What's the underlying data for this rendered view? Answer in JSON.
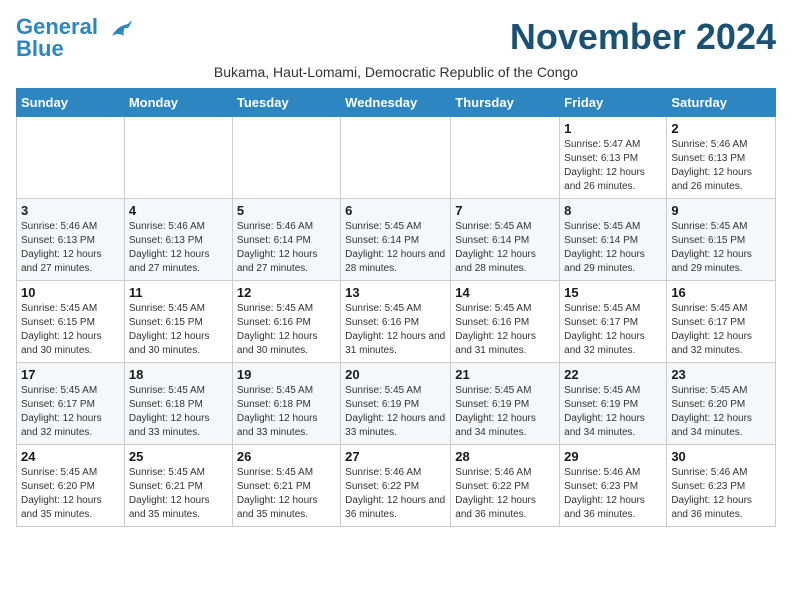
{
  "logo": {
    "line1": "General",
    "line2": "Blue"
  },
  "title": "November 2024",
  "subtitle": "Bukama, Haut-Lomami, Democratic Republic of the Congo",
  "days_of_week": [
    "Sunday",
    "Monday",
    "Tuesday",
    "Wednesday",
    "Thursday",
    "Friday",
    "Saturday"
  ],
  "weeks": [
    [
      {
        "day": "",
        "info": ""
      },
      {
        "day": "",
        "info": ""
      },
      {
        "day": "",
        "info": ""
      },
      {
        "day": "",
        "info": ""
      },
      {
        "day": "",
        "info": ""
      },
      {
        "day": "1",
        "info": "Sunrise: 5:47 AM\nSunset: 6:13 PM\nDaylight: 12 hours and 26 minutes."
      },
      {
        "day": "2",
        "info": "Sunrise: 5:46 AM\nSunset: 6:13 PM\nDaylight: 12 hours and 26 minutes."
      }
    ],
    [
      {
        "day": "3",
        "info": "Sunrise: 5:46 AM\nSunset: 6:13 PM\nDaylight: 12 hours and 27 minutes."
      },
      {
        "day": "4",
        "info": "Sunrise: 5:46 AM\nSunset: 6:13 PM\nDaylight: 12 hours and 27 minutes."
      },
      {
        "day": "5",
        "info": "Sunrise: 5:46 AM\nSunset: 6:14 PM\nDaylight: 12 hours and 27 minutes."
      },
      {
        "day": "6",
        "info": "Sunrise: 5:45 AM\nSunset: 6:14 PM\nDaylight: 12 hours and 28 minutes."
      },
      {
        "day": "7",
        "info": "Sunrise: 5:45 AM\nSunset: 6:14 PM\nDaylight: 12 hours and 28 minutes."
      },
      {
        "day": "8",
        "info": "Sunrise: 5:45 AM\nSunset: 6:14 PM\nDaylight: 12 hours and 29 minutes."
      },
      {
        "day": "9",
        "info": "Sunrise: 5:45 AM\nSunset: 6:15 PM\nDaylight: 12 hours and 29 minutes."
      }
    ],
    [
      {
        "day": "10",
        "info": "Sunrise: 5:45 AM\nSunset: 6:15 PM\nDaylight: 12 hours and 30 minutes."
      },
      {
        "day": "11",
        "info": "Sunrise: 5:45 AM\nSunset: 6:15 PM\nDaylight: 12 hours and 30 minutes."
      },
      {
        "day": "12",
        "info": "Sunrise: 5:45 AM\nSunset: 6:16 PM\nDaylight: 12 hours and 30 minutes."
      },
      {
        "day": "13",
        "info": "Sunrise: 5:45 AM\nSunset: 6:16 PM\nDaylight: 12 hours and 31 minutes."
      },
      {
        "day": "14",
        "info": "Sunrise: 5:45 AM\nSunset: 6:16 PM\nDaylight: 12 hours and 31 minutes."
      },
      {
        "day": "15",
        "info": "Sunrise: 5:45 AM\nSunset: 6:17 PM\nDaylight: 12 hours and 32 minutes."
      },
      {
        "day": "16",
        "info": "Sunrise: 5:45 AM\nSunset: 6:17 PM\nDaylight: 12 hours and 32 minutes."
      }
    ],
    [
      {
        "day": "17",
        "info": "Sunrise: 5:45 AM\nSunset: 6:17 PM\nDaylight: 12 hours and 32 minutes."
      },
      {
        "day": "18",
        "info": "Sunrise: 5:45 AM\nSunset: 6:18 PM\nDaylight: 12 hours and 33 minutes."
      },
      {
        "day": "19",
        "info": "Sunrise: 5:45 AM\nSunset: 6:18 PM\nDaylight: 12 hours and 33 minutes."
      },
      {
        "day": "20",
        "info": "Sunrise: 5:45 AM\nSunset: 6:19 PM\nDaylight: 12 hours and 33 minutes."
      },
      {
        "day": "21",
        "info": "Sunrise: 5:45 AM\nSunset: 6:19 PM\nDaylight: 12 hours and 34 minutes."
      },
      {
        "day": "22",
        "info": "Sunrise: 5:45 AM\nSunset: 6:19 PM\nDaylight: 12 hours and 34 minutes."
      },
      {
        "day": "23",
        "info": "Sunrise: 5:45 AM\nSunset: 6:20 PM\nDaylight: 12 hours and 34 minutes."
      }
    ],
    [
      {
        "day": "24",
        "info": "Sunrise: 5:45 AM\nSunset: 6:20 PM\nDaylight: 12 hours and 35 minutes."
      },
      {
        "day": "25",
        "info": "Sunrise: 5:45 AM\nSunset: 6:21 PM\nDaylight: 12 hours and 35 minutes."
      },
      {
        "day": "26",
        "info": "Sunrise: 5:45 AM\nSunset: 6:21 PM\nDaylight: 12 hours and 35 minutes."
      },
      {
        "day": "27",
        "info": "Sunrise: 5:46 AM\nSunset: 6:22 PM\nDaylight: 12 hours and 36 minutes."
      },
      {
        "day": "28",
        "info": "Sunrise: 5:46 AM\nSunset: 6:22 PM\nDaylight: 12 hours and 36 minutes."
      },
      {
        "day": "29",
        "info": "Sunrise: 5:46 AM\nSunset: 6:23 PM\nDaylight: 12 hours and 36 minutes."
      },
      {
        "day": "30",
        "info": "Sunrise: 5:46 AM\nSunset: 6:23 PM\nDaylight: 12 hours and 36 minutes."
      }
    ]
  ]
}
